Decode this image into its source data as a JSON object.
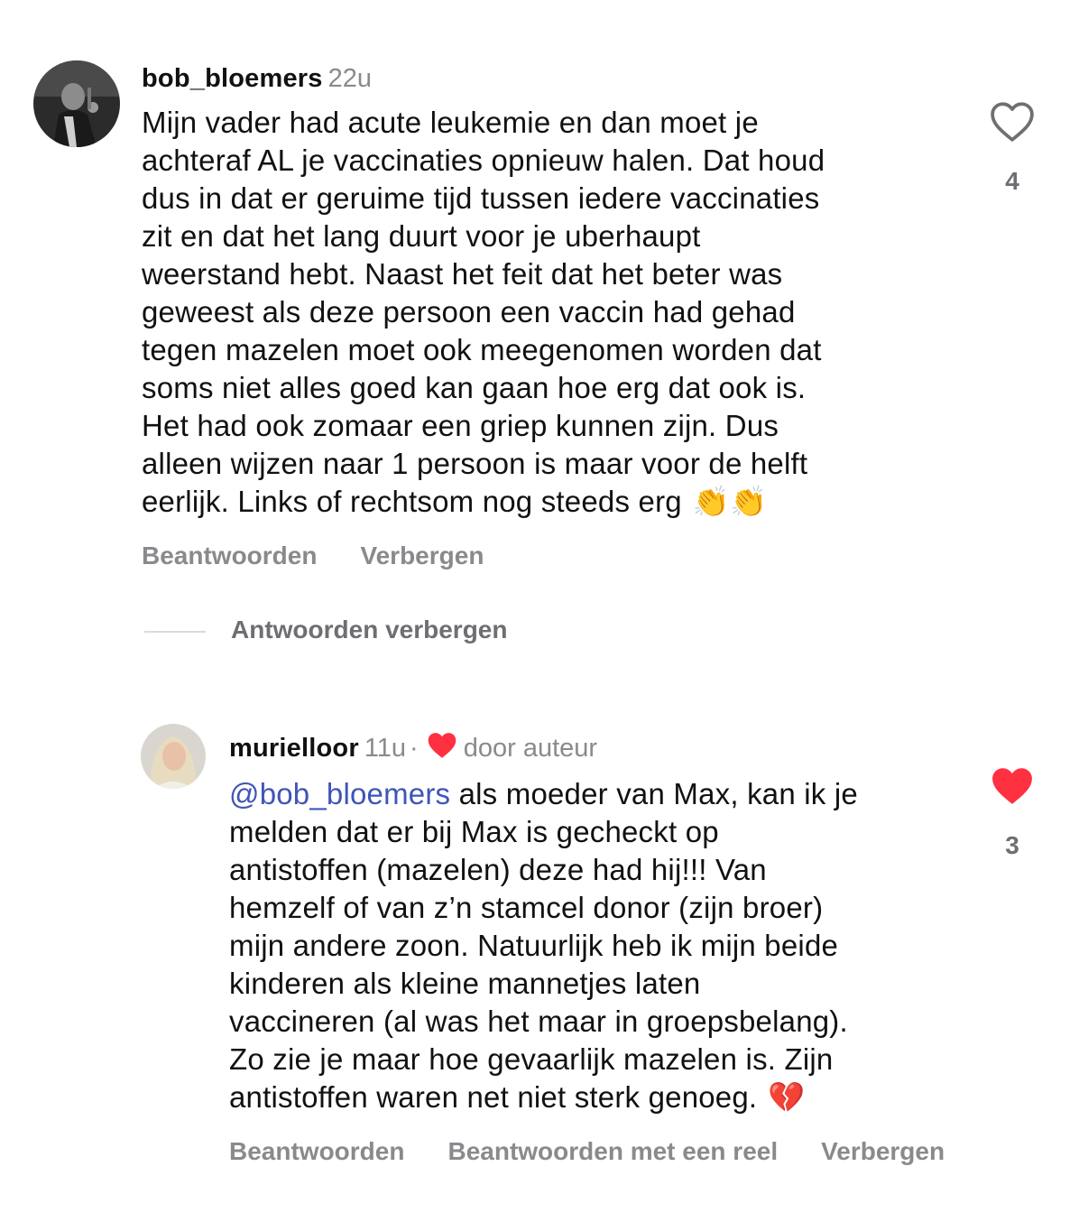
{
  "comments": [
    {
      "username": "bob_bloemers",
      "time": "22u",
      "lines": [
        "Mijn vader had acute leukemie en dan moet je",
        "achteraf AL je vaccinaties opnieuw halen. Dat houd",
        "dus in dat er geruime tijd tussen iedere vaccinaties",
        "zit en dat het lang duurt voor je uberhaupt",
        "weerstand hebt. Naast het feit dat het beter was",
        "geweest als deze persoon een vaccin had gehad",
        "tegen mazelen moet ook meegenomen worden dat",
        "soms niet alles goed kan gaan hoe erg dat ook is.",
        "Het had ook zomaar een griep kunnen zijn. Dus",
        "alleen wijzen naar 1 persoon is maar voor de helft",
        "eerlijk. Links of rechtsom nog steeds erg"
      ],
      "emoji": "👏👏",
      "likes": "4",
      "liked": false,
      "actions": [
        "Beantwoorden",
        "Verbergen"
      ]
    }
  ],
  "replies_toggle": "Antwoorden verbergen",
  "reply": {
    "username": "murielloor",
    "time": "11u",
    "separator": "·",
    "author_label": "door auteur",
    "mention": "@bob_bloemers",
    "first_line_rest": " als moeder van Max, kan ik je",
    "lines": [
      "melden dat er bij Max is gecheckt op",
      "antistoffen (mazelen) deze had hij!!! Van",
      "hemzelf of van z’n stamcel donor (zijn broer)",
      "mijn andere zoon. Natuurlijk heb ik mijn beide",
      "kinderen als kleine mannetjes laten",
      "vaccineren (al was het maar in groepsbelang).",
      "Zo zie je maar hoe gevaarlijk mazelen is. Zijn",
      "antistoffen waren net niet sterk genoeg."
    ],
    "emoji": "💔",
    "likes": "3",
    "liked": true,
    "actions": [
      "Beantwoorden",
      "Beantwoorden met een reel",
      "Verbergen"
    ]
  },
  "colors": {
    "like_active": "#ff3040",
    "mention": "#3f55b8",
    "muted": "#8a8a8e"
  }
}
